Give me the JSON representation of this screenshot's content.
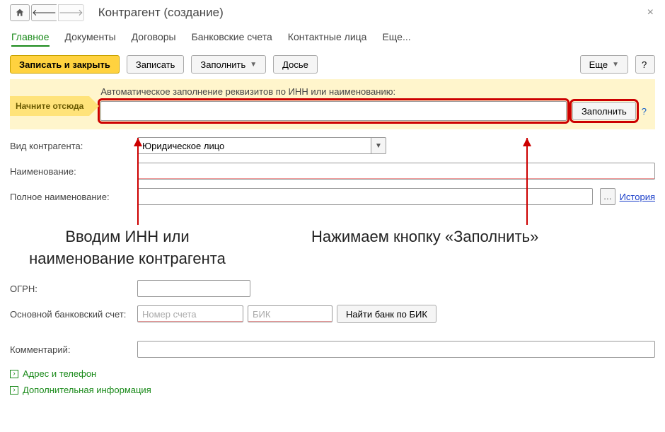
{
  "title": "Контрагент (создание)",
  "tabs": [
    "Главное",
    "Документы",
    "Договоры",
    "Банковские счета",
    "Контактные лица",
    "Еще..."
  ],
  "activeTab": 0,
  "toolbar": {
    "save_close": "Записать и закрыть",
    "save": "Записать",
    "fill": "Заполнить",
    "dossier": "Досье",
    "more": "Еще",
    "help": "?"
  },
  "auto": {
    "start_here": "Начните отсюда",
    "label": "Автоматическое заполнение реквизитов по ИНН или наименованию:",
    "fill_btn": "Заполнить",
    "help": "?"
  },
  "fields": {
    "type_label": "Вид контрагента:",
    "type_value": "Юридическое лицо",
    "name_label": "Наименование:",
    "fullname_label": "Полное наименование:",
    "history_link": "История",
    "ogrn_label": "ОГРН:",
    "bank_label": "Основной банковский счет:",
    "bank_acc_ph": "Номер счета",
    "bank_bik_ph": "БИК",
    "bank_find_btn": "Найти банк по БИК",
    "comment_label": "Комментарий:"
  },
  "sections": {
    "address": "Адрес и телефон",
    "extra": "Дополнительная информация"
  },
  "annotations": {
    "left": "Вводим ИНН или\nнаименование контрагента",
    "right": "Нажимаем кнопку «Заполнить»"
  }
}
